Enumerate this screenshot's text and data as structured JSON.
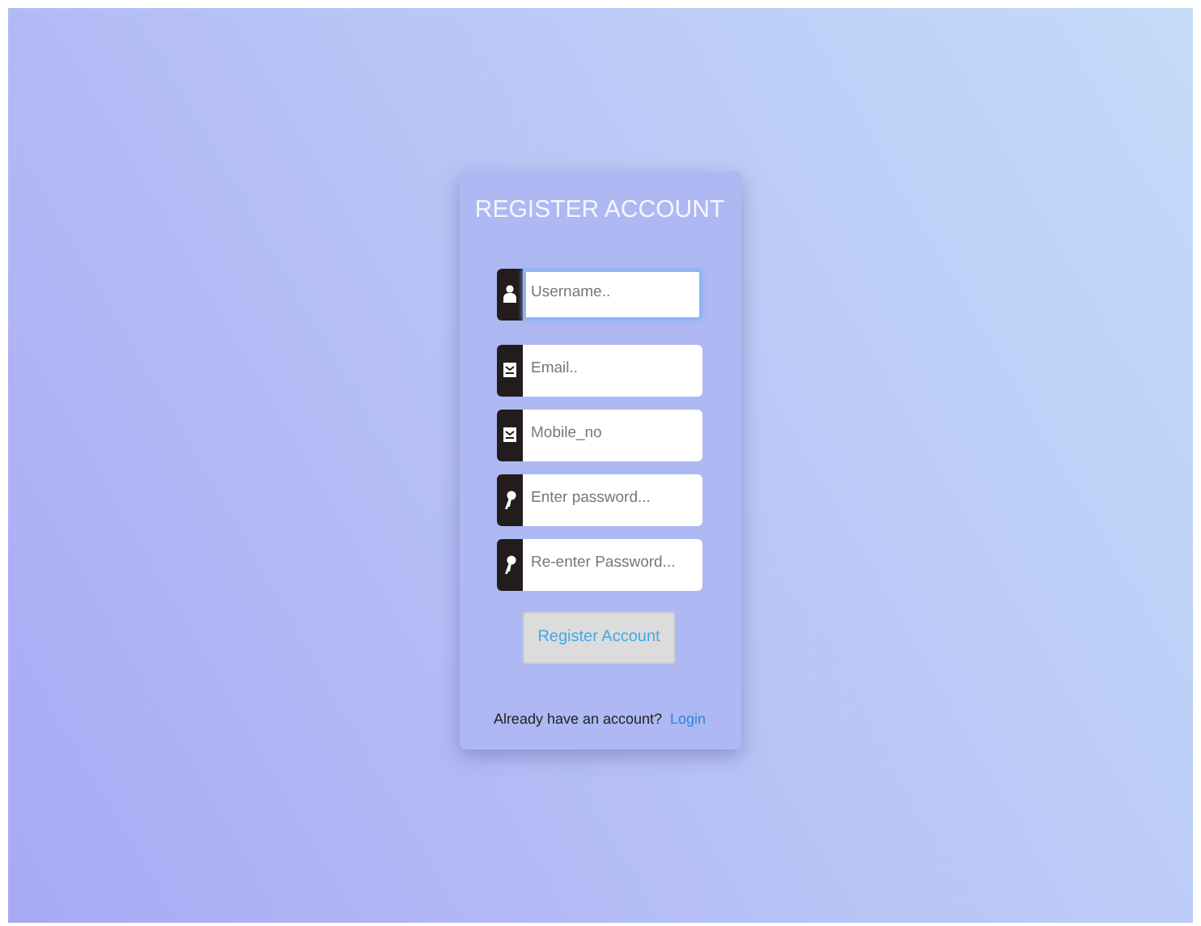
{
  "form": {
    "title": "REGISTER ACCOUNT",
    "fields": [
      {
        "kind": "user",
        "placeholder": "Username..",
        "focused": true
      },
      {
        "kind": "mail",
        "placeholder": "Email..",
        "focused": false
      },
      {
        "kind": "mail",
        "placeholder": "Mobile_no",
        "focused": false
      },
      {
        "kind": "key",
        "placeholder": "Enter password...",
        "focused": false
      },
      {
        "kind": "key",
        "placeholder": "Re-enter Password...",
        "focused": false
      }
    ],
    "submit": "Register Account",
    "footer_text": "Already have an account?",
    "footer_link": "Login"
  }
}
